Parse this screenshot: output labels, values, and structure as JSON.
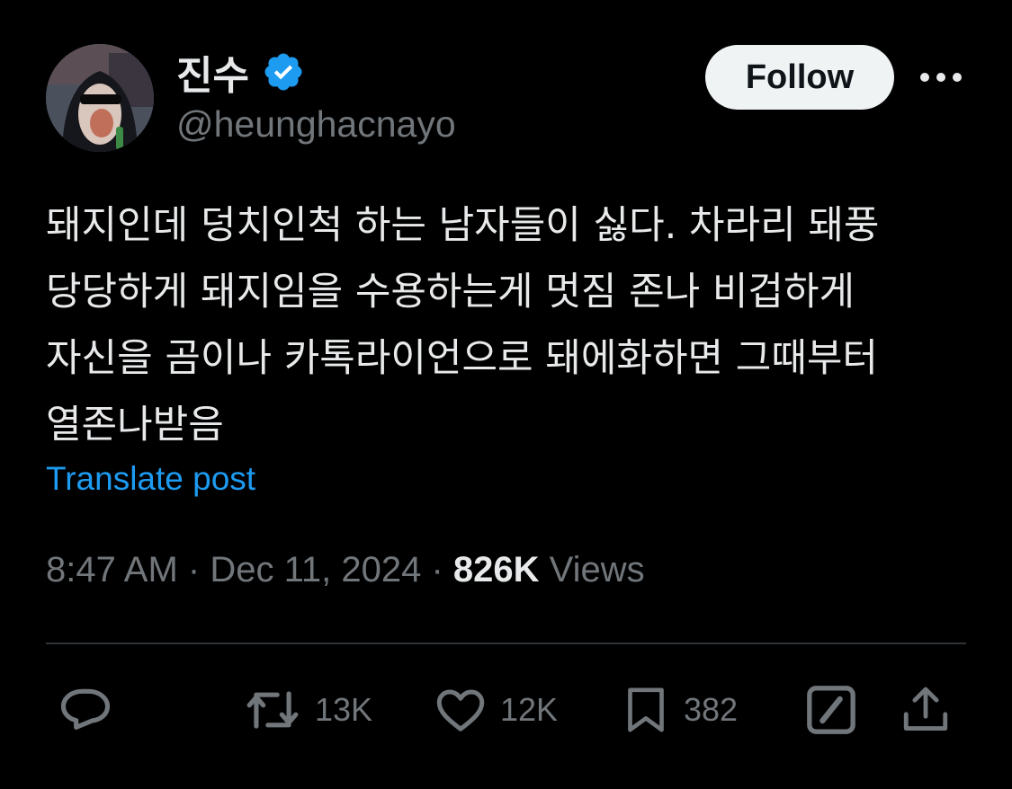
{
  "user": {
    "display_name": "진수",
    "handle": "@heunghacnayo",
    "verified": true,
    "verified_color": "#1d9bf0"
  },
  "header": {
    "follow_label": "Follow",
    "more_icon": "more-horizontal-icon"
  },
  "tweet": {
    "text": "돼지인데 덩치인척 하는 남자들이 싫다. 차라리 돼풍\n당당하게 돼지임을 수용하는게 멋짐 존나 비겁하게\n자신을 곰이나 카톡라이언으로 돼에화하면 그때부터\n열존나받음",
    "translate_label": "Translate post"
  },
  "meta": {
    "time": "8:47 AM",
    "separator": "·",
    "date": "Dec 11, 2024",
    "views_count": "826K",
    "views_label": "Views"
  },
  "actions": {
    "reply": {
      "icon": "reply-icon"
    },
    "retweet": {
      "icon": "retweet-icon",
      "count": "13K"
    },
    "like": {
      "icon": "heart-icon",
      "count": "12K"
    },
    "bookmark": {
      "icon": "bookmark-icon",
      "count": "382"
    },
    "grok": {
      "icon": "grok-icon"
    },
    "share": {
      "icon": "share-icon"
    }
  },
  "colors": {
    "background": "#000000",
    "text_primary": "#e7e9ea",
    "text_secondary": "#71767b",
    "accent": "#1d9bf0",
    "divider": "#2f3336"
  }
}
